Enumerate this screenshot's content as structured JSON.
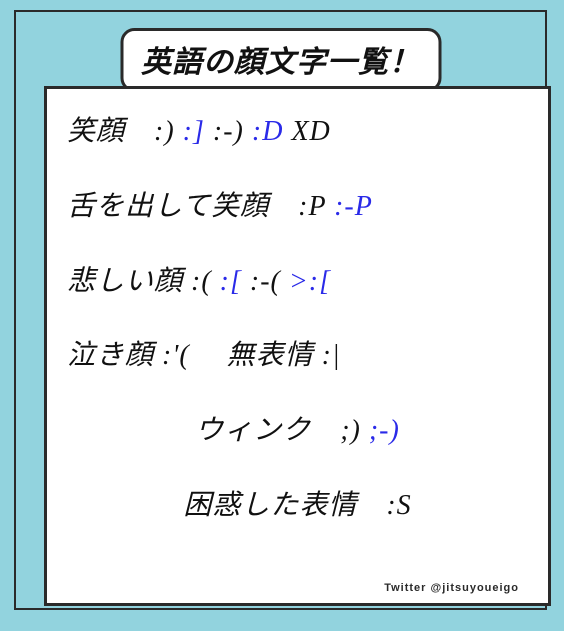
{
  "title": "英語の顔文字一覧！",
  "rows": [
    {
      "align": "left",
      "tokens": [
        {
          "text": "笑顔　",
          "blue": false
        },
        {
          "text": ":)",
          "blue": false
        },
        {
          "text": " ",
          "blue": false
        },
        {
          "text": ":]",
          "blue": true
        },
        {
          "text": " ",
          "blue": false
        },
        {
          "text": ":-)",
          "blue": false
        },
        {
          "text": " ",
          "blue": false
        },
        {
          "text": ":D",
          "blue": true
        },
        {
          "text": " ",
          "blue": false
        },
        {
          "text": "XD",
          "blue": false
        }
      ]
    },
    {
      "align": "left",
      "tokens": [
        {
          "text": "舌を出して笑顔　",
          "blue": false
        },
        {
          "text": ":P",
          "blue": false
        },
        {
          "text": " ",
          "blue": false
        },
        {
          "text": ":-P",
          "blue": true
        }
      ]
    },
    {
      "align": "left",
      "tokens": [
        {
          "text": "悲しい顔 ",
          "blue": false
        },
        {
          "text": ":(",
          "blue": false
        },
        {
          "text": " ",
          "blue": false
        },
        {
          "text": ":[",
          "blue": true
        },
        {
          "text": " ",
          "blue": false
        },
        {
          "text": ":-(",
          "blue": false
        },
        {
          "text": " ",
          "blue": false
        },
        {
          "text": ">:[",
          "blue": true
        }
      ]
    },
    {
      "align": "left",
      "tokens": [
        {
          "text": "泣き顔 ",
          "blue": false
        },
        {
          "text": ":'(",
          "blue": false
        },
        {
          "text": "　 無表情 ",
          "blue": false
        },
        {
          "text": ":|",
          "blue": false
        }
      ]
    },
    {
      "align": "center",
      "tokens": [
        {
          "text": "ウィンク　",
          "blue": false
        },
        {
          "text": ";)",
          "blue": false
        },
        {
          "text": " ",
          "blue": false
        },
        {
          "text": ";-)",
          "blue": true
        }
      ]
    },
    {
      "align": "center",
      "tokens": [
        {
          "text": "困惑した表情　",
          "blue": false
        },
        {
          "text": ":S",
          "blue": false
        }
      ]
    }
  ],
  "credit": "Twitter @jitsuyoueigo"
}
